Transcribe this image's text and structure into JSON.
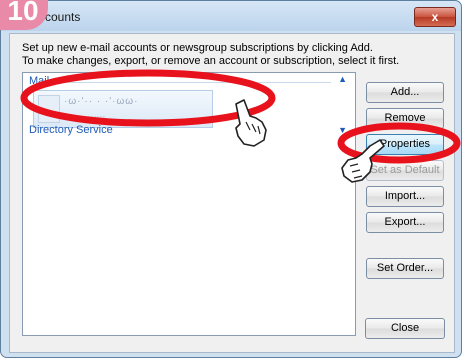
{
  "step_badge": "10",
  "window": {
    "title": "ccounts",
    "close_glyph": "x"
  },
  "instructions": [
    "Set up new e-mail accounts or newsgroup subscriptions by clicking Add.",
    "To make changes, export, or remove an account or subscription, select it first."
  ],
  "list": {
    "mail_header": "Mail",
    "account_name": "·ω·'·· · ·'·ωω·",
    "account_sub": "·· ·······",
    "directory_header": "Directory Service",
    "collapse_glyph": "▲",
    "expand_glyph": "▼"
  },
  "buttons": {
    "add": "Add...",
    "remove": "Remove",
    "properties": "Properties",
    "set_default": "Set as Default",
    "import": "Import...",
    "export": "Export...",
    "set_order": "Set Order...",
    "close": "Close"
  },
  "colors": {
    "highlight_oval": "#e8121c",
    "header_text": "#1e5bb8",
    "badge": "#e88aa8"
  },
  "icons": {
    "pointing_hand_1": "pointing-hand-icon",
    "pointing_hand_2": "pointing-hand-icon"
  }
}
